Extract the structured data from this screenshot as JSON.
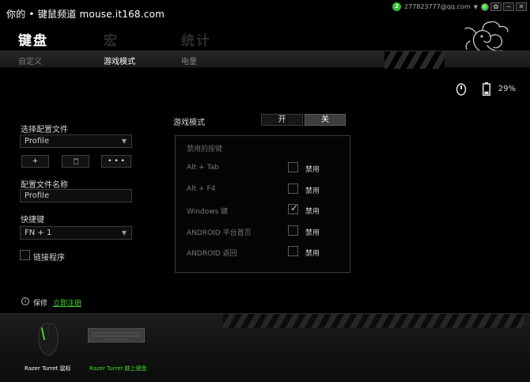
{
  "watermark": "你的 • 键鼠频道 mouse.it168.com",
  "account": {
    "badge": "2",
    "email": "277823777@qq.com",
    "caret": "▼"
  },
  "window_controls": {
    "gear": "✿",
    "minimize": "−",
    "close": "✕"
  },
  "main_tabs": {
    "keyboard": "键盘",
    "macro": "宏",
    "stats": "统计"
  },
  "sub_tabs": {
    "customize": "自定义",
    "game_mode": "游戏模式",
    "power": "电量"
  },
  "battery": {
    "percent": "29%"
  },
  "profile": {
    "select_label": "选择配置文件",
    "selected": "Profile",
    "add": "+",
    "more": "• • •",
    "name_label": "配置文件名称",
    "name_value": "Profile",
    "hotkey_label": "快捷键",
    "hotkey_value": "FN + 1",
    "link_program": "链接程序"
  },
  "game_mode": {
    "label": "游戏模式",
    "on": "开",
    "off": "关",
    "selected": "关"
  },
  "disabled_keys": {
    "title": "禁用的按键",
    "ban_label": "禁用",
    "rows": [
      {
        "key": "Alt + Tab",
        "checked": false
      },
      {
        "key": "Alt + F4",
        "checked": false
      },
      {
        "key": "Windows 键",
        "checked": true
      },
      {
        "key": "ANDROID 平台首页",
        "checked": false
      },
      {
        "key": "ANDROID 返回",
        "checked": false
      }
    ]
  },
  "warranty": {
    "label": "保修",
    "register_link": "立即注册"
  },
  "devices": [
    {
      "name": "Razer Turret 鼠标"
    },
    {
      "name": "Razer Turret 膝上键盘"
    }
  ],
  "colors": {
    "accent": "#44d62c",
    "background": "#000000"
  }
}
